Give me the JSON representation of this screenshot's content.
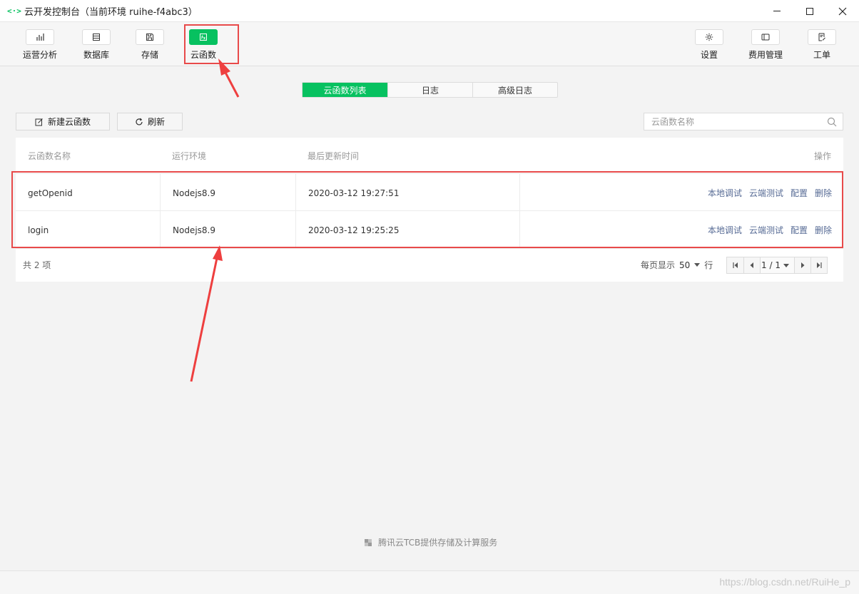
{
  "window": {
    "title": "云开发控制台（当前环境 ruihe-f4abc3）",
    "app_icon": "<·>"
  },
  "toolbar": {
    "left": [
      {
        "label": "运营分析",
        "icon": "bar-chart-icon"
      },
      {
        "label": "数据库",
        "icon": "database-icon"
      },
      {
        "label": "存储",
        "icon": "save-icon"
      },
      {
        "label": "云函数",
        "icon": "function-icon",
        "active": true
      }
    ],
    "right": [
      {
        "label": "设置",
        "icon": "gear-icon"
      },
      {
        "label": "费用管理",
        "icon": "billing-icon"
      },
      {
        "label": "工单",
        "icon": "ticket-icon"
      }
    ]
  },
  "tabs": [
    {
      "label": "云函数列表",
      "active": true
    },
    {
      "label": "日志"
    },
    {
      "label": "高级日志"
    }
  ],
  "actions": {
    "new_label": "新建云函数",
    "refresh_label": "刷新"
  },
  "search": {
    "placeholder": "云函数名称",
    "value": ""
  },
  "table": {
    "headers": [
      "云函数名称",
      "运行环境",
      "最后更新时间",
      "操作"
    ],
    "rows": [
      {
        "name": "getOpenid",
        "runtime": "Nodejs8.9",
        "updated": "2020-03-12 19:27:51"
      },
      {
        "name": "login",
        "runtime": "Nodejs8.9",
        "updated": "2020-03-12 19:25:25"
      }
    ],
    "ops": [
      "本地调试",
      "云端测试",
      "配置",
      "删除"
    ]
  },
  "footer": {
    "total": "共 2 项",
    "per_page_label": "每页显示",
    "per_page_value": "50",
    "row_unit": "行",
    "page": "1 / 1"
  },
  "brand_text": "腾讯云TCB提供存储及计算服务",
  "watermark": "https://blog.csdn.net/RuiHe_p",
  "colors": {
    "accent": "#07c160",
    "highlight": "#e84a4a",
    "link": "#576b95"
  }
}
